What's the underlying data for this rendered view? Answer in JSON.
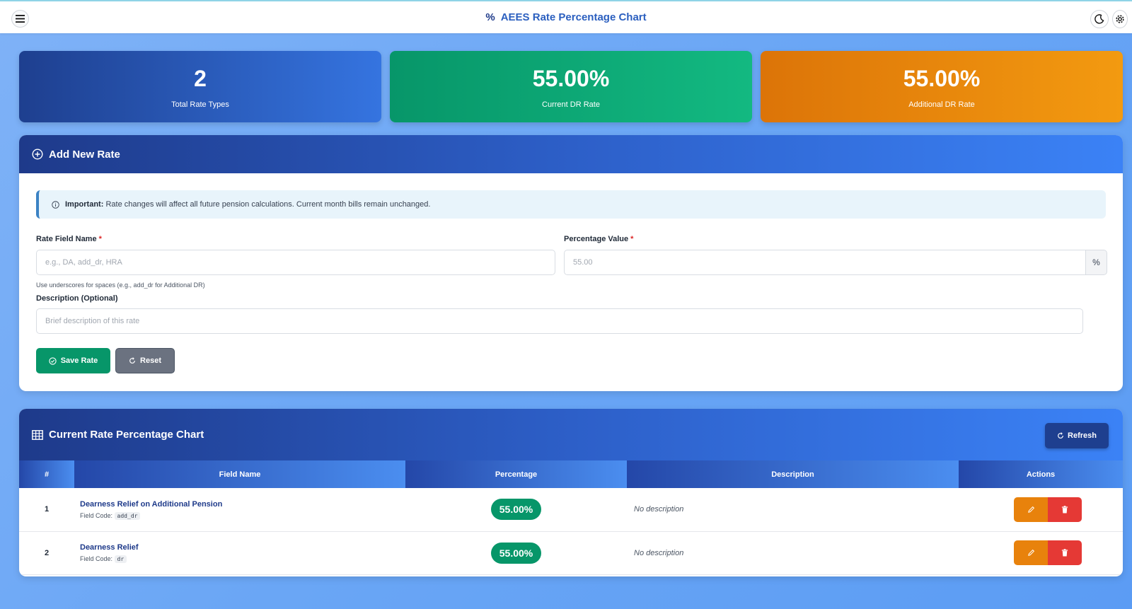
{
  "header": {
    "title_icon": "%",
    "title": "AEES Rate Percentage Chart",
    "icons": [
      "menu-icon",
      "moon-icon",
      "gear-icon"
    ]
  },
  "stats": [
    {
      "value": "2",
      "label": "Total Rate Types",
      "color": "#2b5fc8"
    },
    {
      "value": "55.00%",
      "label": "Current DR Rate",
      "color": "#10a877"
    },
    {
      "value": "55.00%",
      "label": "Additional DR Rate",
      "color": "#e8870c"
    }
  ],
  "add_form": {
    "title": "Add New Rate",
    "alert_strong": "Important:",
    "alert_text": "Rate changes will affect all future pension calculations. Current month bills remain unchanged.",
    "field_name_label": "Rate Field Name",
    "required_mark": "*",
    "field_name_placeholder": "e.g., DA, add_dr, HRA",
    "field_name_hint": "Use underscores for spaces (e.g., add_dr for Additional DR)",
    "percentage_label": "Percentage Value",
    "percentage_placeholder": "55.00",
    "percentage_suffix": "%",
    "description_label": "Description (Optional)",
    "description_placeholder": "Brief description of this rate",
    "save_label": "Save Rate",
    "reset_label": "Reset"
  },
  "rates_table": {
    "title": "Current Rate Percentage Chart",
    "refresh_label": "Refresh",
    "columns": [
      "#",
      "Field Name",
      "Percentage",
      "Description",
      "Actions"
    ],
    "code_prefix": "Field Code:",
    "rows": [
      {
        "index": "1",
        "name": "Dearness Relief on Additional Pension",
        "code": "add_dr",
        "percentage": "55.00%",
        "description": "No description"
      },
      {
        "index": "2",
        "name": "Dearness Relief",
        "code": "dr",
        "percentage": "55.00%",
        "description": "No description"
      }
    ]
  },
  "colors": {
    "accent": "#2563eb",
    "success": "#079669",
    "warning": "#e8820c",
    "danger": "#e53935"
  }
}
